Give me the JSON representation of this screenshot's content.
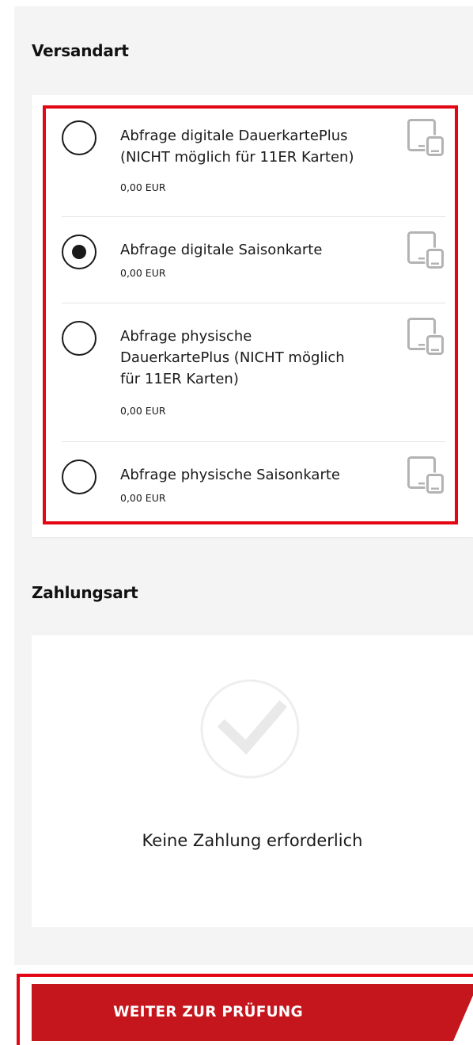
{
  "shipping": {
    "title": "Versandart",
    "options": [
      {
        "label": "Abfrage digitale DauerkartePlus\n(NICHT möglich für 11ER Karten)",
        "price": "0,00 EUR",
        "selected": false,
        "icon": "device-icon"
      },
      {
        "label": "Abfrage digitale Saisonkarte",
        "price": "0,00 EUR",
        "selected": true,
        "icon": "device-icon"
      },
      {
        "label": "Abfrage physische\nDauerkartePlus (NICHT möglich\nfür 11ER Karten)",
        "price": "0,00 EUR",
        "selected": false,
        "icon": "device-icon"
      },
      {
        "label": "Abfrage physische Saisonkarte",
        "price": "0,00 EUR",
        "selected": false,
        "icon": "device-icon"
      }
    ]
  },
  "payment": {
    "title": "Zahlungsart",
    "message": "Keine Zahlung erforderlich",
    "icon": "checkmark-circle-icon"
  },
  "cta": {
    "label": "WEITER ZUR PRÜFUNG"
  },
  "colors": {
    "highlight": "#e30613",
    "button": "#c4161c",
    "panel_bg": "#f4f4f4",
    "icon_gray": "#b3b3b3"
  }
}
